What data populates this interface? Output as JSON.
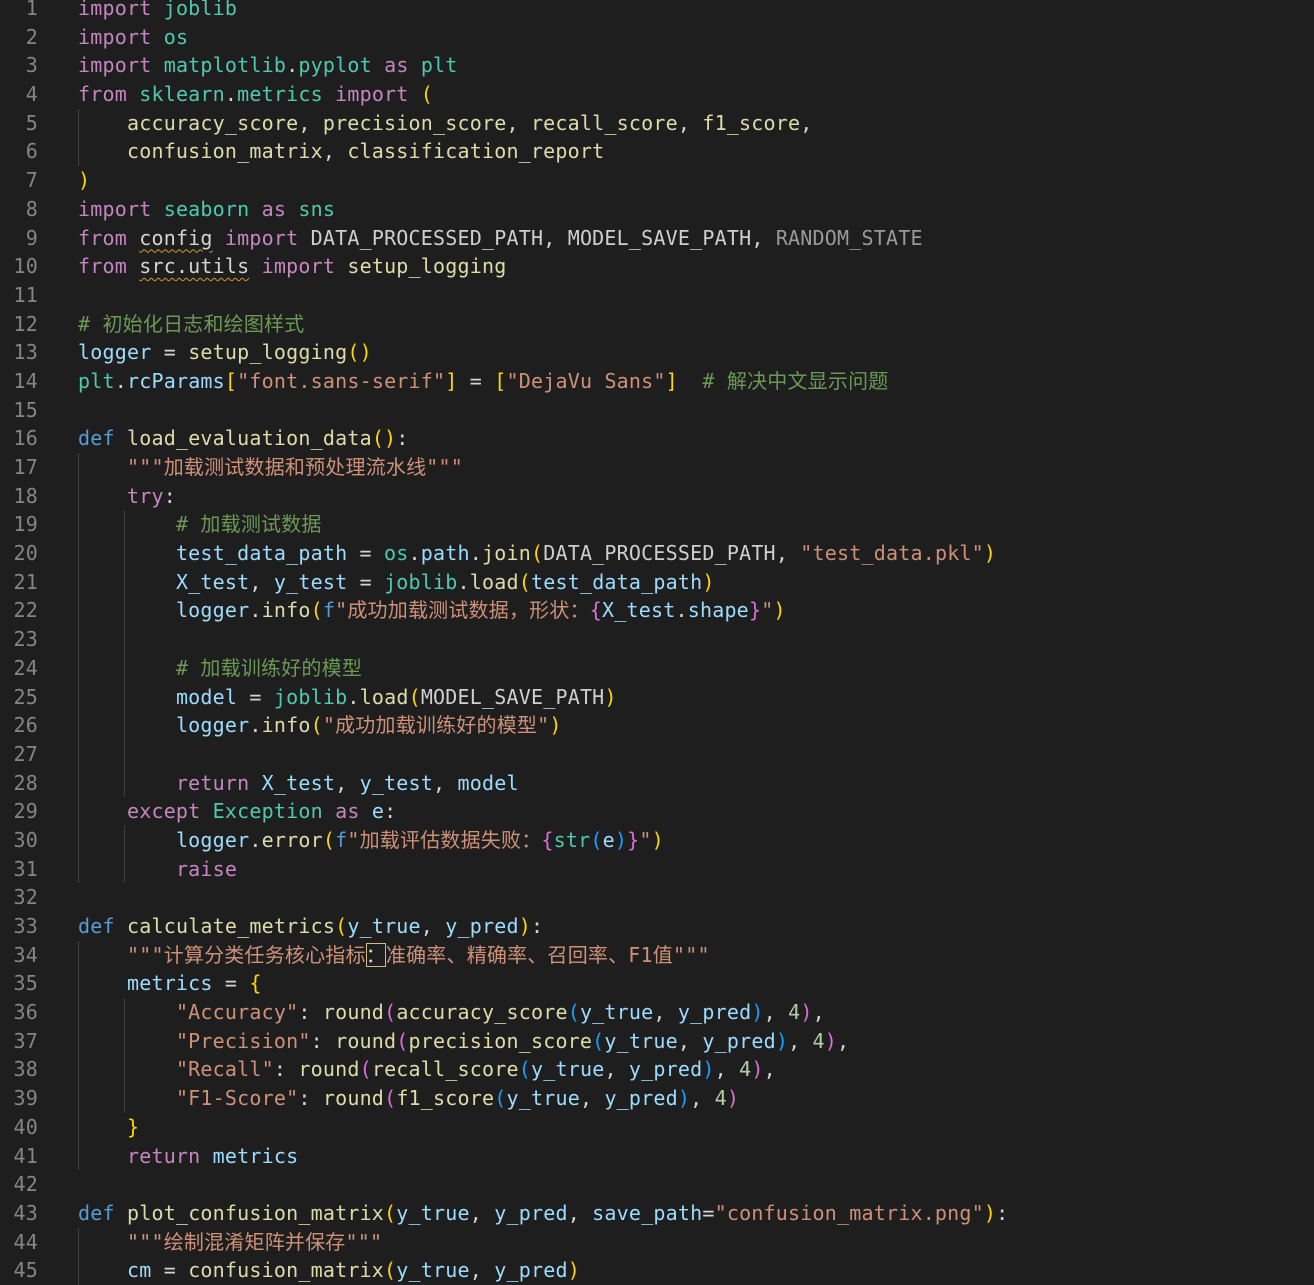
{
  "lines": [
    {
      "n": "1",
      "tokens": [
        [
          "kw",
          "import"
        ],
        [
          "",
          " "
        ],
        [
          "mod",
          "joblib"
        ]
      ]
    },
    {
      "n": "2",
      "tokens": [
        [
          "kw",
          "import"
        ],
        [
          "",
          " "
        ],
        [
          "mod",
          "os"
        ]
      ]
    },
    {
      "n": "3",
      "tokens": [
        [
          "kw",
          "import"
        ],
        [
          "",
          " "
        ],
        [
          "mod",
          "matplotlib"
        ],
        [
          "",
          "."
        ],
        [
          "mod",
          "pyplot"
        ],
        [
          "",
          " "
        ],
        [
          "kw",
          "as"
        ],
        [
          "",
          " "
        ],
        [
          "mod",
          "plt"
        ]
      ]
    },
    {
      "n": "4",
      "tokens": [
        [
          "kw",
          "from"
        ],
        [
          "",
          " "
        ],
        [
          "mod",
          "sklearn"
        ],
        [
          "",
          "."
        ],
        [
          "mod",
          "metrics"
        ],
        [
          "",
          " "
        ],
        [
          "kw",
          "import"
        ],
        [
          "",
          " "
        ],
        [
          "p1",
          "("
        ]
      ]
    },
    {
      "n": "5",
      "guides": [
        1
      ],
      "tokens": [
        [
          "",
          "    "
        ],
        [
          "fn",
          "accuracy_score"
        ],
        [
          "",
          ", "
        ],
        [
          "fn",
          "precision_score"
        ],
        [
          "",
          ", "
        ],
        [
          "fn",
          "recall_score"
        ],
        [
          "",
          ", "
        ],
        [
          "fn",
          "f1_score"
        ],
        [
          "",
          ","
        ]
      ]
    },
    {
      "n": "6",
      "guides": [
        1
      ],
      "tokens": [
        [
          "",
          "    "
        ],
        [
          "fn",
          "confusion_matrix"
        ],
        [
          "",
          ", "
        ],
        [
          "fn",
          "classification_report"
        ]
      ]
    },
    {
      "n": "7",
      "tokens": [
        [
          "p1",
          ")"
        ]
      ]
    },
    {
      "n": "8",
      "tokens": [
        [
          "kw",
          "import"
        ],
        [
          "",
          " "
        ],
        [
          "mod",
          "seaborn"
        ],
        [
          "",
          " "
        ],
        [
          "kw",
          "as"
        ],
        [
          "",
          " "
        ],
        [
          "mod",
          "sns"
        ]
      ]
    },
    {
      "n": "9",
      "tokens": [
        [
          "kw",
          "from"
        ],
        [
          "",
          " "
        ],
        [
          "squig",
          "config"
        ],
        [
          "",
          " "
        ],
        [
          "kw",
          "import"
        ],
        [
          "",
          " "
        ],
        [
          "const",
          "DATA_PROCESSED_PATH"
        ],
        [
          "",
          ", "
        ],
        [
          "const",
          "MODEL_SAVE_PATH"
        ],
        [
          "",
          ", "
        ],
        [
          "dim",
          "RANDOM_STATE"
        ]
      ]
    },
    {
      "n": "10",
      "tokens": [
        [
          "kw",
          "from"
        ],
        [
          "",
          " "
        ],
        [
          "squig",
          "src.utils"
        ],
        [
          "",
          " "
        ],
        [
          "kw",
          "import"
        ],
        [
          "",
          " "
        ],
        [
          "fn",
          "setup_logging"
        ]
      ]
    },
    {
      "n": "11",
      "tokens": []
    },
    {
      "n": "12",
      "tokens": [
        [
          "cmt",
          "# 初始化日志和绘图样式"
        ]
      ]
    },
    {
      "n": "13",
      "tokens": [
        [
          "var",
          "logger"
        ],
        [
          "",
          " = "
        ],
        [
          "fn",
          "setup_logging"
        ],
        [
          "p1",
          "()"
        ]
      ]
    },
    {
      "n": "14",
      "tokens": [
        [
          "mod",
          "plt"
        ],
        [
          "",
          "."
        ],
        [
          "var",
          "rcParams"
        ],
        [
          "p1",
          "["
        ],
        [
          "str",
          "\"font.sans-serif\""
        ],
        [
          "p1",
          "]"
        ],
        [
          "",
          " = "
        ],
        [
          "p1",
          "["
        ],
        [
          "str",
          "\"DejaVu Sans\""
        ],
        [
          "p1",
          "]"
        ],
        [
          "",
          "  "
        ],
        [
          "cmt",
          "# 解决中文显示问题"
        ]
      ]
    },
    {
      "n": "15",
      "tokens": []
    },
    {
      "n": "16",
      "tokens": [
        [
          "kb",
          "def"
        ],
        [
          "",
          " "
        ],
        [
          "fn",
          "load_evaluation_data"
        ],
        [
          "p1",
          "()"
        ],
        [
          "",
          ":"
        ]
      ]
    },
    {
      "n": "17",
      "guides": [
        1
      ],
      "tokens": [
        [
          "",
          "    "
        ],
        [
          "str",
          "\"\"\"加载测试数据和预处理流水线\"\"\""
        ]
      ]
    },
    {
      "n": "18",
      "guides": [
        1
      ],
      "tokens": [
        [
          "",
          "    "
        ],
        [
          "kw",
          "try"
        ],
        [
          "",
          ":"
        ]
      ]
    },
    {
      "n": "19",
      "guides": [
        1,
        2
      ],
      "tokens": [
        [
          "",
          "        "
        ],
        [
          "cmt",
          "# 加载测试数据"
        ]
      ]
    },
    {
      "n": "20",
      "guides": [
        1,
        2
      ],
      "tokens": [
        [
          "",
          "        "
        ],
        [
          "var",
          "test_data_path"
        ],
        [
          "",
          " = "
        ],
        [
          "mod",
          "os"
        ],
        [
          "",
          "."
        ],
        [
          "var",
          "path"
        ],
        [
          "",
          "."
        ],
        [
          "fn",
          "join"
        ],
        [
          "p1",
          "("
        ],
        [
          "const",
          "DATA_PROCESSED_PATH"
        ],
        [
          "",
          ", "
        ],
        [
          "str",
          "\"test_data.pkl\""
        ],
        [
          "p1",
          ")"
        ]
      ]
    },
    {
      "n": "21",
      "guides": [
        1,
        2
      ],
      "tokens": [
        [
          "",
          "        "
        ],
        [
          "var",
          "X_test"
        ],
        [
          "",
          ", "
        ],
        [
          "var",
          "y_test"
        ],
        [
          "",
          " = "
        ],
        [
          "mod",
          "joblib"
        ],
        [
          "",
          "."
        ],
        [
          "fn",
          "load"
        ],
        [
          "p1",
          "("
        ],
        [
          "var",
          "test_data_path"
        ],
        [
          "p1",
          ")"
        ]
      ]
    },
    {
      "n": "22",
      "guides": [
        1,
        2
      ],
      "tokens": [
        [
          "",
          "        "
        ],
        [
          "var",
          "logger"
        ],
        [
          "",
          "."
        ],
        [
          "fn",
          "info"
        ],
        [
          "p1",
          "("
        ],
        [
          "kb",
          "f"
        ],
        [
          "str",
          "\"成功加载测试数据，形状："
        ],
        [
          "p2",
          "{"
        ],
        [
          "var",
          "X_test"
        ],
        [
          "",
          "."
        ],
        [
          "var",
          "shape"
        ],
        [
          "p2",
          "}"
        ],
        [
          "str",
          "\""
        ],
        [
          "p1",
          ")"
        ]
      ]
    },
    {
      "n": "23",
      "guides": [
        1,
        2
      ],
      "tokens": []
    },
    {
      "n": "24",
      "guides": [
        1,
        2
      ],
      "tokens": [
        [
          "",
          "        "
        ],
        [
          "cmt",
          "# 加载训练好的模型"
        ]
      ]
    },
    {
      "n": "25",
      "guides": [
        1,
        2
      ],
      "tokens": [
        [
          "",
          "        "
        ],
        [
          "var",
          "model"
        ],
        [
          "",
          " = "
        ],
        [
          "mod",
          "joblib"
        ],
        [
          "",
          "."
        ],
        [
          "fn",
          "load"
        ],
        [
          "p1",
          "("
        ],
        [
          "const",
          "MODEL_SAVE_PATH"
        ],
        [
          "p1",
          ")"
        ]
      ]
    },
    {
      "n": "26",
      "guides": [
        1,
        2
      ],
      "tokens": [
        [
          "",
          "        "
        ],
        [
          "var",
          "logger"
        ],
        [
          "",
          "."
        ],
        [
          "fn",
          "info"
        ],
        [
          "p1",
          "("
        ],
        [
          "str",
          "\"成功加载训练好的模型\""
        ],
        [
          "p1",
          ")"
        ]
      ]
    },
    {
      "n": "27",
      "guides": [
        1,
        2
      ],
      "tokens": []
    },
    {
      "n": "28",
      "guides": [
        1,
        2
      ],
      "tokens": [
        [
          "",
          "        "
        ],
        [
          "kw",
          "return"
        ],
        [
          "",
          " "
        ],
        [
          "var",
          "X_test"
        ],
        [
          "",
          ", "
        ],
        [
          "var",
          "y_test"
        ],
        [
          "",
          ", "
        ],
        [
          "var",
          "model"
        ]
      ]
    },
    {
      "n": "29",
      "guides": [
        1
      ],
      "tokens": [
        [
          "",
          "    "
        ],
        [
          "kw",
          "except"
        ],
        [
          "",
          " "
        ],
        [
          "mod",
          "Exception"
        ],
        [
          "",
          " "
        ],
        [
          "kw",
          "as"
        ],
        [
          "",
          " "
        ],
        [
          "var",
          "e"
        ],
        [
          "",
          ":"
        ]
      ]
    },
    {
      "n": "30",
      "guides": [
        1,
        2
      ],
      "tokens": [
        [
          "",
          "        "
        ],
        [
          "var",
          "logger"
        ],
        [
          "",
          "."
        ],
        [
          "fn",
          "error"
        ],
        [
          "p1",
          "("
        ],
        [
          "kb",
          "f"
        ],
        [
          "str",
          "\"加载评估数据失败："
        ],
        [
          "p2",
          "{"
        ],
        [
          "mod",
          "str"
        ],
        [
          "p3",
          "("
        ],
        [
          "var",
          "e"
        ],
        [
          "p3",
          ")"
        ],
        [
          "p2",
          "}"
        ],
        [
          "str",
          "\""
        ],
        [
          "p1",
          ")"
        ]
      ]
    },
    {
      "n": "31",
      "guides": [
        1,
        2
      ],
      "tokens": [
        [
          "",
          "        "
        ],
        [
          "kw",
          "raise"
        ]
      ]
    },
    {
      "n": "32",
      "tokens": []
    },
    {
      "n": "33",
      "tokens": [
        [
          "kb",
          "def"
        ],
        [
          "",
          " "
        ],
        [
          "fn",
          "calculate_metrics"
        ],
        [
          "p1",
          "("
        ],
        [
          "var",
          "y_true"
        ],
        [
          "",
          ", "
        ],
        [
          "var",
          "y_pred"
        ],
        [
          "p1",
          ")"
        ],
        [
          "",
          ":"
        ]
      ]
    },
    {
      "n": "34",
      "guides": [
        1
      ],
      "tokens": [
        [
          "",
          "    "
        ],
        [
          "str",
          "\"\"\"计算分类任务核心指标"
        ],
        [
          "boxed",
          "："
        ],
        [
          "str",
          "准确率、精确率、召回率、F1值\"\"\""
        ]
      ]
    },
    {
      "n": "35",
      "guides": [
        1
      ],
      "tokens": [
        [
          "",
          "    "
        ],
        [
          "var",
          "metrics"
        ],
        [
          "",
          " = "
        ],
        [
          "p1",
          "{"
        ]
      ]
    },
    {
      "n": "36",
      "guides": [
        1,
        2
      ],
      "tokens": [
        [
          "",
          "        "
        ],
        [
          "str",
          "\"Accuracy\""
        ],
        [
          "",
          ": "
        ],
        [
          "fn",
          "round"
        ],
        [
          "p2",
          "("
        ],
        [
          "fn",
          "accuracy_score"
        ],
        [
          "p3",
          "("
        ],
        [
          "var",
          "y_true"
        ],
        [
          "",
          ", "
        ],
        [
          "var",
          "y_pred"
        ],
        [
          "p3",
          ")"
        ],
        [
          "",
          ", "
        ],
        [
          "num",
          "4"
        ],
        [
          "p2",
          ")"
        ],
        [
          "",
          ","
        ]
      ]
    },
    {
      "n": "37",
      "guides": [
        1,
        2
      ],
      "tokens": [
        [
          "",
          "        "
        ],
        [
          "str",
          "\"Precision\""
        ],
        [
          "",
          ": "
        ],
        [
          "fn",
          "round"
        ],
        [
          "p2",
          "("
        ],
        [
          "fn",
          "precision_score"
        ],
        [
          "p3",
          "("
        ],
        [
          "var",
          "y_true"
        ],
        [
          "",
          ", "
        ],
        [
          "var",
          "y_pred"
        ],
        [
          "p3",
          ")"
        ],
        [
          "",
          ", "
        ],
        [
          "num",
          "4"
        ],
        [
          "p2",
          ")"
        ],
        [
          "",
          ","
        ]
      ]
    },
    {
      "n": "38",
      "guides": [
        1,
        2
      ],
      "tokens": [
        [
          "",
          "        "
        ],
        [
          "str",
          "\"Recall\""
        ],
        [
          "",
          ": "
        ],
        [
          "fn",
          "round"
        ],
        [
          "p2",
          "("
        ],
        [
          "fn",
          "recall_score"
        ],
        [
          "p3",
          "("
        ],
        [
          "var",
          "y_true"
        ],
        [
          "",
          ", "
        ],
        [
          "var",
          "y_pred"
        ],
        [
          "p3",
          ")"
        ],
        [
          "",
          ", "
        ],
        [
          "num",
          "4"
        ],
        [
          "p2",
          ")"
        ],
        [
          "",
          ","
        ]
      ]
    },
    {
      "n": "39",
      "guides": [
        1,
        2
      ],
      "tokens": [
        [
          "",
          "        "
        ],
        [
          "str",
          "\"F1-Score\""
        ],
        [
          "",
          ": "
        ],
        [
          "fn",
          "round"
        ],
        [
          "p2",
          "("
        ],
        [
          "fn",
          "f1_score"
        ],
        [
          "p3",
          "("
        ],
        [
          "var",
          "y_true"
        ],
        [
          "",
          ", "
        ],
        [
          "var",
          "y_pred"
        ],
        [
          "p3",
          ")"
        ],
        [
          "",
          ", "
        ],
        [
          "num",
          "4"
        ],
        [
          "p2",
          ")"
        ]
      ]
    },
    {
      "n": "40",
      "guides": [
        1
      ],
      "tokens": [
        [
          "",
          "    "
        ],
        [
          "p1",
          "}"
        ]
      ]
    },
    {
      "n": "41",
      "guides": [
        1
      ],
      "tokens": [
        [
          "",
          "    "
        ],
        [
          "kw",
          "return"
        ],
        [
          "",
          " "
        ],
        [
          "var",
          "metrics"
        ]
      ]
    },
    {
      "n": "42",
      "tokens": []
    },
    {
      "n": "43",
      "tokens": [
        [
          "kb",
          "def"
        ],
        [
          "",
          " "
        ],
        [
          "fn",
          "plot_confusion_matrix"
        ],
        [
          "p1",
          "("
        ],
        [
          "var",
          "y_true"
        ],
        [
          "",
          ", "
        ],
        [
          "var",
          "y_pred"
        ],
        [
          "",
          ", "
        ],
        [
          "var",
          "save_path"
        ],
        [
          "",
          "="
        ],
        [
          "str",
          "\"confusion_matrix.png\""
        ],
        [
          "p1",
          ")"
        ],
        [
          "",
          ":"
        ]
      ]
    },
    {
      "n": "44",
      "guides": [
        1
      ],
      "tokens": [
        [
          "",
          "    "
        ],
        [
          "str",
          "\"\"\"绘制混淆矩阵并保存\"\"\""
        ]
      ]
    },
    {
      "n": "45",
      "guides": [
        1
      ],
      "tokens": [
        [
          "",
          "    "
        ],
        [
          "var",
          "cm"
        ],
        [
          "",
          " = "
        ],
        [
          "fn",
          "confusion_matrix"
        ],
        [
          "p1",
          "("
        ],
        [
          "var",
          "y_true"
        ],
        [
          "",
          ", "
        ],
        [
          "var",
          "y_pred"
        ],
        [
          "p1",
          ")"
        ]
      ]
    }
  ]
}
